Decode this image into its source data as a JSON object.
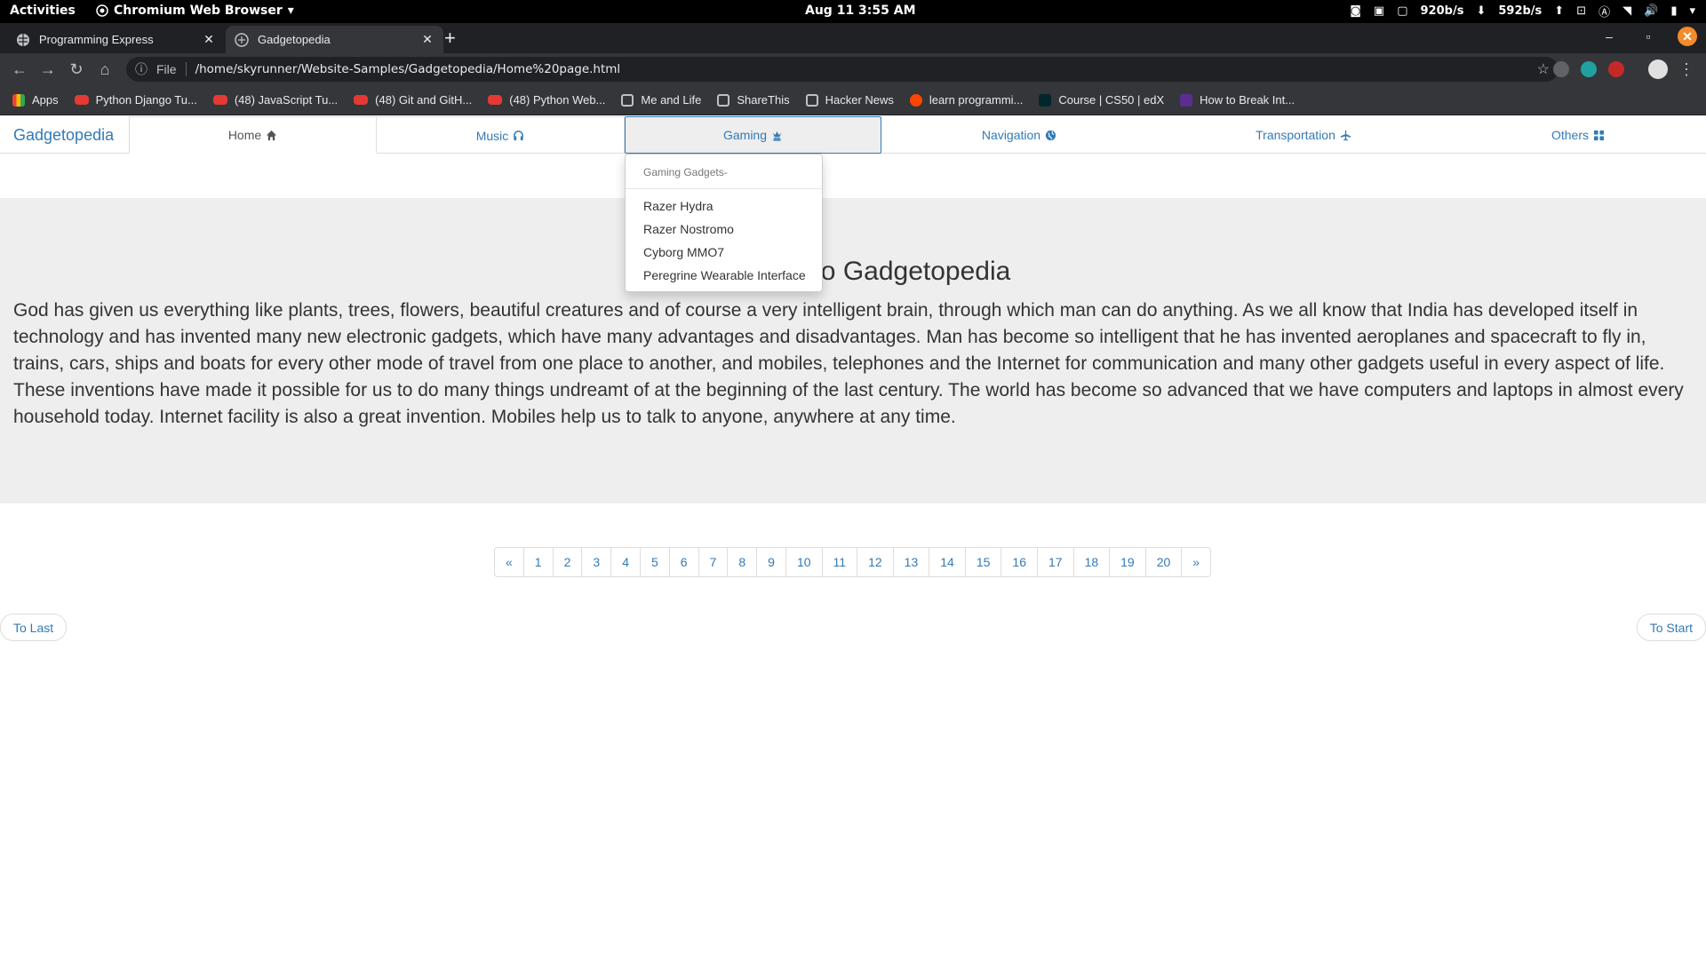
{
  "system_bar": {
    "activities": "Activities",
    "app_name": "Chromium Web Browser",
    "clock": "Aug 11  3:55 AM",
    "net_down": "920b/s",
    "net_up": "592b/s"
  },
  "browser": {
    "tabs": [
      {
        "title": "Programming Express"
      },
      {
        "title": "Gadgetopedia"
      }
    ],
    "url_chip": "File",
    "url": "/home/skyrunner/Website-Samples/Gadgetopedia/Home%20page.html",
    "bookmarks": [
      {
        "label": "Apps",
        "icon": "apps-grid-icon"
      },
      {
        "label": "Python Django Tu...",
        "icon": "youtube-icon"
      },
      {
        "label": "(48) JavaScript Tu...",
        "icon": "youtube-icon"
      },
      {
        "label": "(48) Git and GitH...",
        "icon": "youtube-icon"
      },
      {
        "label": "(48) Python Web...",
        "icon": "youtube-icon"
      },
      {
        "label": "Me and Life",
        "icon": "globe-icon"
      },
      {
        "label": "ShareThis",
        "icon": "globe-icon"
      },
      {
        "label": "Hacker News",
        "icon": "globe-icon"
      },
      {
        "label": "learn programmi...",
        "icon": "reddit-icon"
      },
      {
        "label": "Course | CS50 | edX",
        "icon": "edx-icon"
      },
      {
        "label": "How to Break Int...",
        "icon": "terminal-icon"
      }
    ]
  },
  "site": {
    "brand": "Gadgetopedia",
    "nav": [
      {
        "label": "Home",
        "icon": "home-icon"
      },
      {
        "label": "Music",
        "icon": "headphones-icon"
      },
      {
        "label": "Gaming",
        "icon": "chess-king-icon"
      },
      {
        "label": "Navigation",
        "icon": "globe-icon"
      },
      {
        "label": "Transportation",
        "icon": "plane-icon"
      },
      {
        "label": "Others",
        "icon": "grid-icon"
      }
    ],
    "dropdown": {
      "header": "Gaming Gadgets-",
      "items": [
        "Razer Hydra",
        "Razer Nostromo",
        "Cyborg MMO7",
        "Peregrine Wearable Interface"
      ]
    },
    "jumbotron": {
      "title": "Welcome to Gadgetopedia",
      "text": "God has given us everything like plants, trees, flowers, beautiful creatures and of course a very intelligent brain, through which man can do anything. As we all know that India has developed itself in technology and has invented many new electronic gadgets, which have many advantages and disadvantages. Man has become so intelligent that he has invented aeroplanes and spacecraft to fly in, trains, cars, ships and boats for every other mode of travel from one place to another, and mobiles, telephones and the Internet for communication and many other gadgets useful in every aspect of life. These inventions have made it possible for us to do many things undreamt of at the beginning of the last century. The world has become so advanced that we have computers and laptops in almost every household today. Internet facility is also a great invention. Mobiles help us to talk to anyone, anywhere at any time."
    },
    "pagination": [
      "«",
      "1",
      "2",
      "3",
      "4",
      "5",
      "6",
      "7",
      "8",
      "9",
      "10",
      "11",
      "12",
      "13",
      "14",
      "15",
      "16",
      "17",
      "18",
      "19",
      "20",
      "»"
    ],
    "pager": {
      "previous": "To Last",
      "next": "To Start"
    }
  }
}
